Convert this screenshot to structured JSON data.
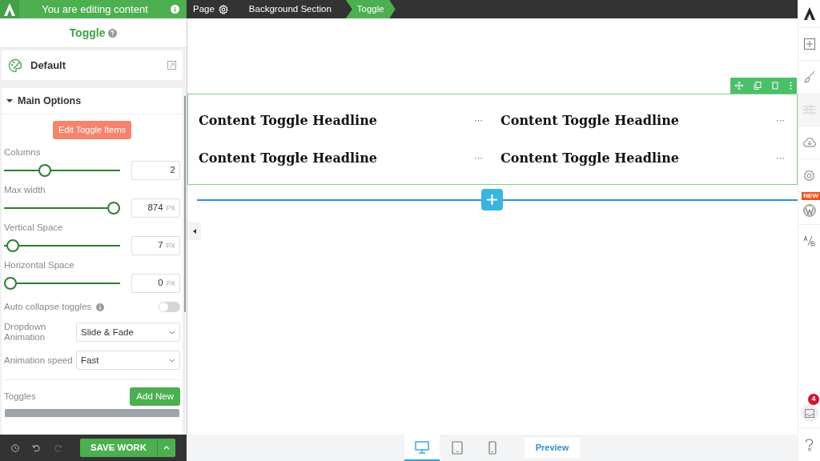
{
  "header": {
    "notice": "You are editing content"
  },
  "breadcrumbs": [
    {
      "label": "Page",
      "kind": "page",
      "selected": false
    },
    {
      "label": "Background Section",
      "kind": "crumb",
      "selected": false
    },
    {
      "label": "Toggle",
      "kind": "crumb",
      "selected": true
    }
  ],
  "panel": {
    "title": "Toggle",
    "style": "Default",
    "section": {
      "title": "Main Options",
      "expanded": true
    },
    "edit_button": "Edit Toggle Items",
    "settings": [
      {
        "kind": "slider",
        "label": "Columns",
        "value": "2",
        "level": 0.33
      },
      {
        "kind": "slider",
        "label": "Max width",
        "value": "874",
        "unit": "PX",
        "level": 1
      },
      {
        "kind": "slider",
        "label": "Vertical Space",
        "value": "7",
        "unit": "PX",
        "level": 0.02
      },
      {
        "kind": "slider",
        "label": "Horizontal Space",
        "value": "0",
        "unit": "PX",
        "level": 0
      },
      {
        "kind": "switch",
        "label": "Auto collapse toggles",
        "on": false
      },
      {
        "kind": "select",
        "label": "Dropdown Animation",
        "value": "Slide & Fade"
      },
      {
        "kind": "select",
        "label": "Animation speed",
        "value": "Fast"
      }
    ],
    "toggles_label": "Toggles",
    "add_button": "Add New"
  },
  "footer": {
    "save_button": "SAVE WORK"
  },
  "canvas": {
    "toggles": [
      {
        "headline": "Content Toggle Headline",
        "more": "···"
      },
      {
        "headline": "Content Toggle Headline",
        "more": "···"
      },
      {
        "headline": "Content Toggle Headline",
        "more": "···"
      },
      {
        "headline": "Content Toggle Headline",
        "more": "···"
      }
    ]
  },
  "devices": [
    {
      "kind": "desktop",
      "selected": true
    },
    {
      "kind": "tablet",
      "selected": false
    },
    {
      "kind": "phone",
      "selected": false
    }
  ],
  "preview_button": "Preview",
  "sidebar": {
    "new_badge": "NEW",
    "notification_count": "4"
  }
}
